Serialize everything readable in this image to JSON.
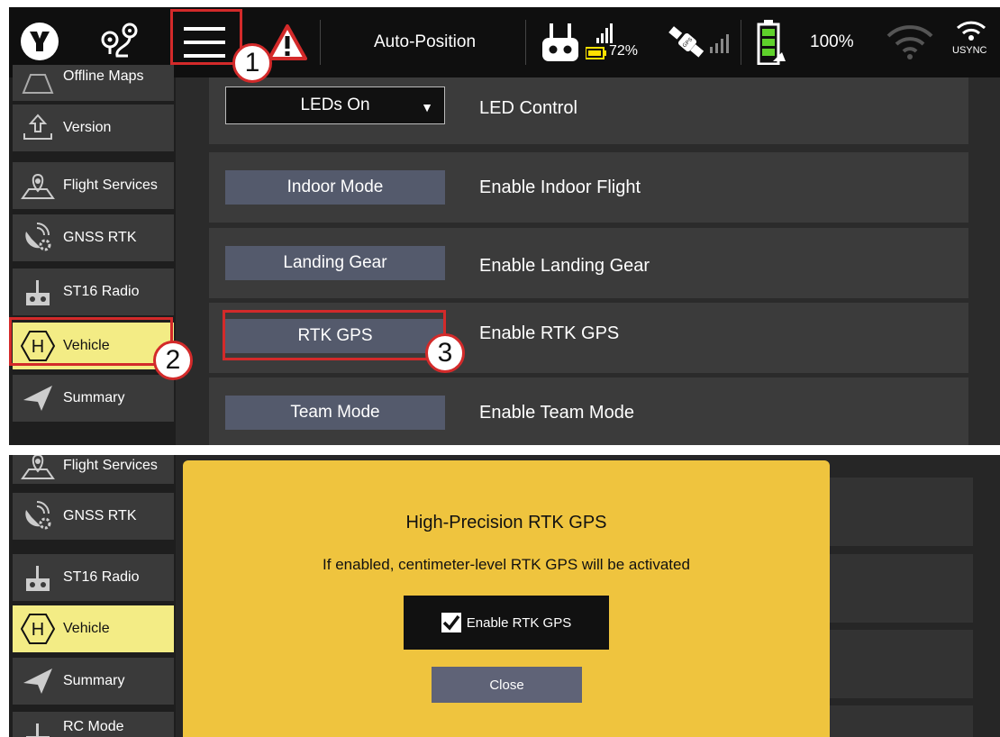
{
  "topbar": {
    "mode_label": "Auto-Position",
    "rc_battery": "72%",
    "drone_battery": "100%",
    "usync_label": "USYNC"
  },
  "sidebar_top": [
    {
      "label": "Offline Maps",
      "icon": "map-icon"
    },
    {
      "label": "Version",
      "icon": "upload-icon"
    },
    {
      "label": "Flight Services",
      "icon": "location-map-icon"
    },
    {
      "label": "GNSS RTK",
      "icon": "satellite-gear-icon"
    },
    {
      "label": "ST16 Radio",
      "icon": "remote-controller-icon"
    },
    {
      "label": "Vehicle",
      "icon": "hexacopter-icon",
      "active": true
    },
    {
      "label": "Summary",
      "icon": "paper-plane-icon"
    }
  ],
  "rows": [
    {
      "control": "LEDs On",
      "label": "LED Control",
      "type": "dropdown"
    },
    {
      "control": "Indoor Mode",
      "label": "Enable Indoor Flight",
      "type": "button"
    },
    {
      "control": "Landing Gear",
      "label": "Enable Landing Gear",
      "type": "button"
    },
    {
      "control": "RTK GPS",
      "label": "Enable RTK GPS",
      "type": "button"
    },
    {
      "control": "Team Mode",
      "label": "Enable Team Mode",
      "type": "button"
    }
  ],
  "callouts": [
    "1",
    "2",
    "3"
  ],
  "sidebar_bottom": [
    {
      "label": "Flight Services",
      "icon": "location-map-icon"
    },
    {
      "label": "GNSS RTK",
      "icon": "satellite-gear-icon"
    },
    {
      "label": "ST16 Radio",
      "icon": "remote-controller-icon"
    },
    {
      "label": "Vehicle",
      "icon": "hexacopter-icon",
      "active": true
    },
    {
      "label": "Summary",
      "icon": "paper-plane-icon"
    },
    {
      "label": "RC Mode",
      "icon": "remote-controller-icon"
    }
  ],
  "modal": {
    "title": "High-Precision RTK GPS",
    "subtitle": "If enabled, centimeter-level RTK GPS will be activated",
    "checkbox_label": "Enable RTK GPS",
    "checkbox_checked": true,
    "close_label": "Close"
  },
  "colors": {
    "highlight": "#d32a2a",
    "active_item": "#f3ec85",
    "modal_bg": "#efc43e",
    "button_bg": "#545a6c"
  }
}
